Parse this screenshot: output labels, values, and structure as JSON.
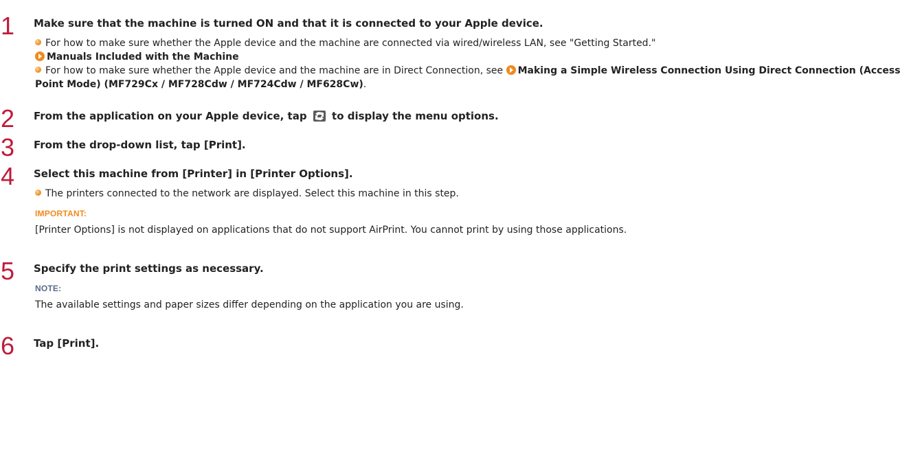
{
  "steps": [
    {
      "number": "1",
      "title": "Make sure that the machine is turned ON and that it is connected to your Apple device.",
      "bullets": [
        {
          "text": "For how to make sure whether the Apple device and the machine are connected via wired/wireless LAN, see \"Getting Started.\"",
          "link": "Manuals Included with the Machine"
        },
        {
          "text": "For how to make sure whether the Apple device and the machine are in Direct Connection, see",
          "link": "Making a Simple Wireless Connection Using Direct Connection (Access Point Mode) (MF729Cx / MF728Cdw / MF724Cdw / MF628Cw)",
          "suffix": "."
        }
      ]
    },
    {
      "number": "2",
      "title_before": "From the application on your Apple device, tap",
      "title_icon": "share-menu-icon",
      "title_after": "to display the menu options."
    },
    {
      "number": "3",
      "title": "From the drop-down list, tap [Print]."
    },
    {
      "number": "4",
      "title": "Select this machine from [Printer] in [Printer Options].",
      "bullet": "The printers connected to the network are displayed. Select this machine in this step.",
      "note_heading": "IMPORTANT:",
      "note_text": "[Printer Options] is not displayed on applications that do not support AirPrint. You cannot print by using those applications."
    },
    {
      "number": "5",
      "title": "Specify the print settings as necessary.",
      "note_heading": "NOTE:",
      "note_text": "The available settings and paper sizes differ depending on the application you are using."
    },
    {
      "number": "6",
      "title": "Tap [Print]."
    }
  ],
  "colors": {
    "step_number": "#c01a3a",
    "important_heading": "#f08a1e",
    "note_heading": "#556b8a",
    "link_arrow": "#f08a1e"
  }
}
